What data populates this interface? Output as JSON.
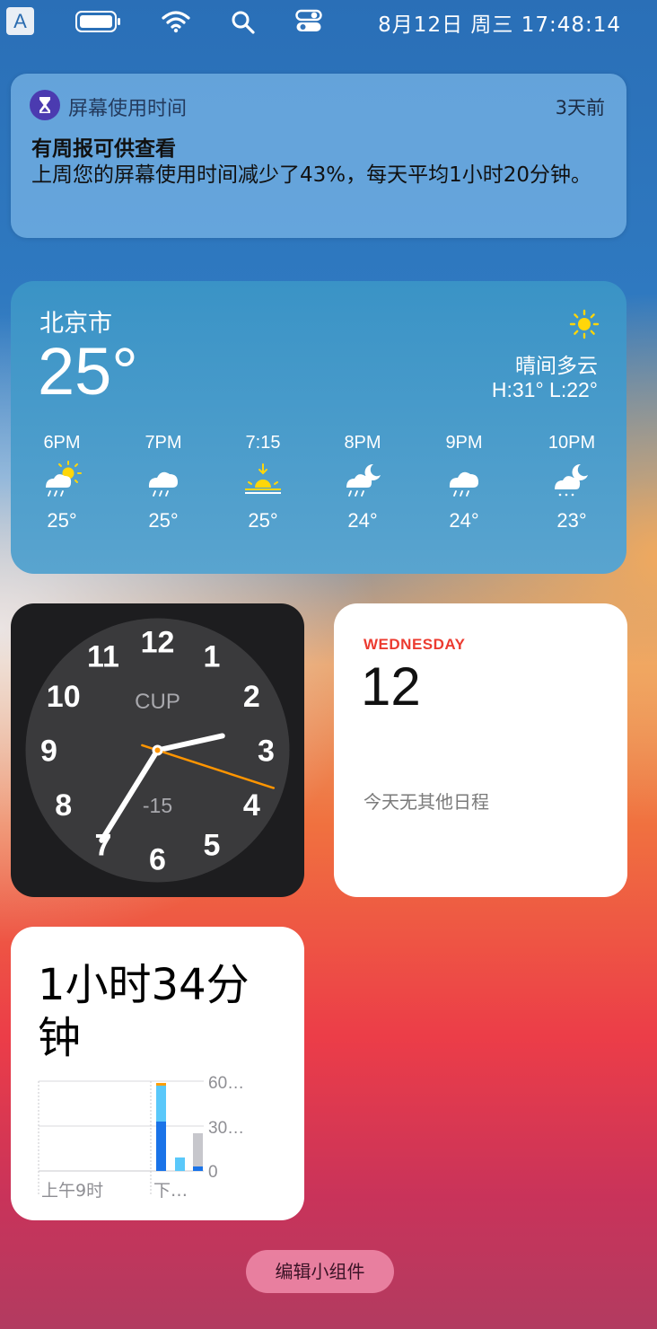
{
  "menubar": {
    "input_indicator": "A",
    "clock": "8月12日 周三  17:48:14",
    "icons": [
      "input-source-icon",
      "battery-icon",
      "wifi-icon",
      "spotlight-search-icon",
      "control-center-icon"
    ]
  },
  "notification": {
    "app": "屏幕使用时间",
    "time": "3天前",
    "title": "有周报可供查看",
    "body": "上周您的屏幕使用时间减少了43%，每天平均1小时20分钟。",
    "icon": "hourglass-icon"
  },
  "weather": {
    "city": "北京市",
    "temp": "25°",
    "condition": "晴间多云",
    "high_low": "H:31° L:22°",
    "condition_icon": "sun-icon",
    "hours": [
      {
        "time": "6PM",
        "icon": "sun-cloud-rain-icon",
        "temp": "25°"
      },
      {
        "time": "7PM",
        "icon": "cloud-rain-icon",
        "temp": "25°"
      },
      {
        "time": "7:15",
        "icon": "sunset-icon",
        "temp": "25°"
      },
      {
        "time": "8PM",
        "icon": "moon-cloud-rain-icon",
        "temp": "24°"
      },
      {
        "time": "9PM",
        "icon": "cloud-rain-icon",
        "temp": "24°"
      },
      {
        "time": "10PM",
        "icon": "moon-cloud-icon",
        "temp": "23°"
      }
    ]
  },
  "clock": {
    "city": "CUP",
    "offset": "-15",
    "time": {
      "hours": 2,
      "minutes": 35,
      "seconds": 18
    },
    "accent": "#ff9500",
    "numerals": [
      "12",
      "1",
      "2",
      "3",
      "4",
      "5",
      "6",
      "7",
      "8",
      "9",
      "10",
      "11"
    ]
  },
  "calendar": {
    "weekday": "WEDNESDAY",
    "date": "12",
    "no_events": "今天无其他日程",
    "accent": "#ec3b30"
  },
  "screentime": {
    "total": "1小时34分钟",
    "x_labels": [
      "上午9时",
      "下…"
    ],
    "y_labels": [
      "60…",
      "30…",
      "0"
    ],
    "bars": [
      {
        "segments": [
          {
            "color": "#1a73e8",
            "fraction": 0.55
          },
          {
            "color": "#5ac8fa",
            "fraction": 0.4
          },
          {
            "color": "#ff9f0a",
            "fraction": 0.03
          }
        ]
      },
      {
        "segments": [
          {
            "color": "#5ac8fa",
            "fraction": 0.15
          }
        ]
      },
      {
        "segments": [
          {
            "color": "#1a73e8",
            "fraction": 0.05
          },
          {
            "color": "#c7c7cc",
            "fraction": 0.37
          }
        ]
      }
    ]
  },
  "edit_widgets": "编辑小组件"
}
